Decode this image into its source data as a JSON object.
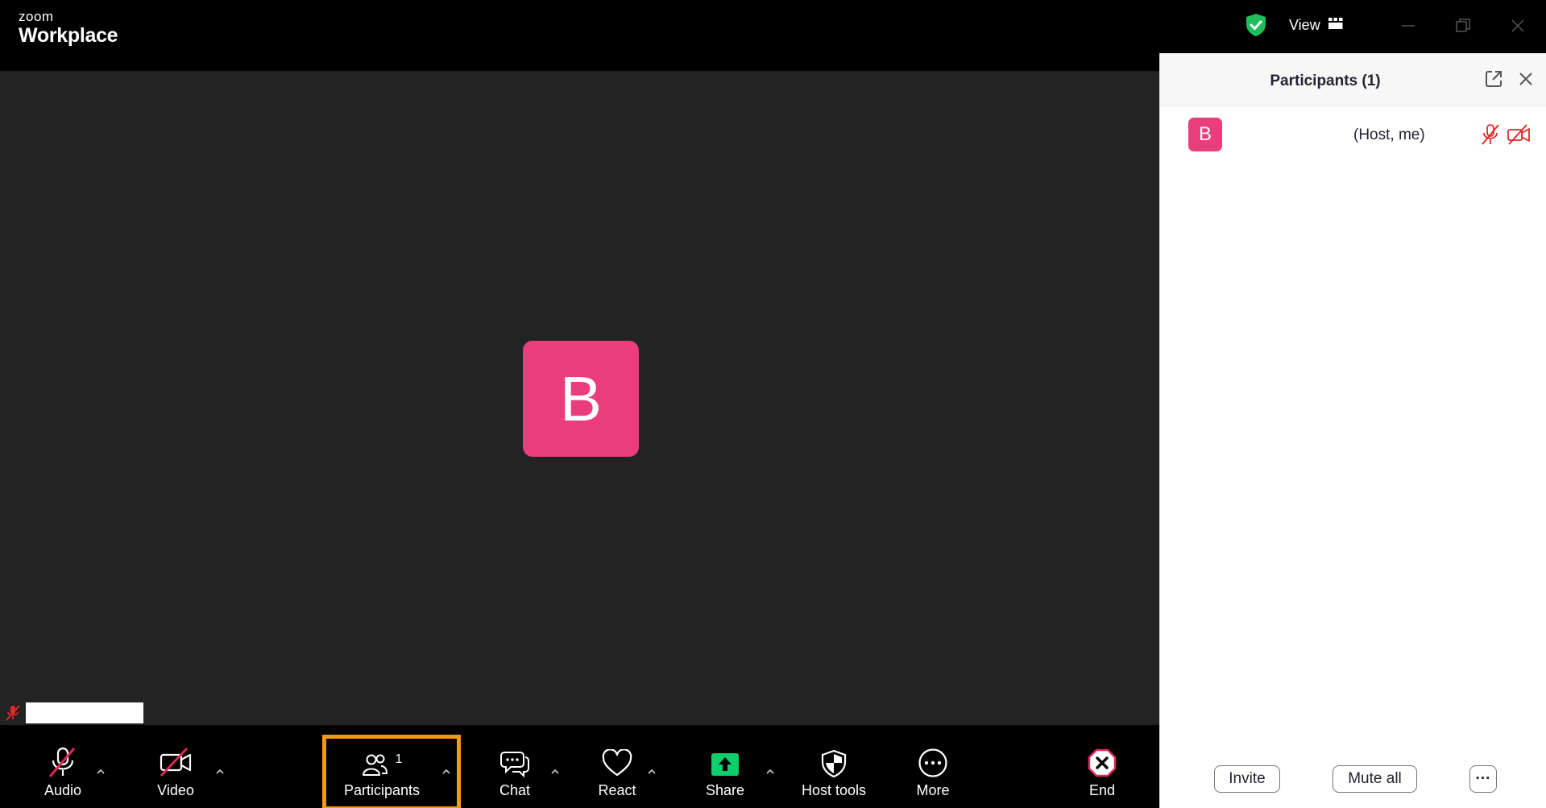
{
  "window": {
    "logo_top": "zoom",
    "logo_bottom": "Workplace",
    "view_label": "View"
  },
  "video": {
    "avatar_letter": "B"
  },
  "toolbar": {
    "audio_label": "Audio",
    "video_label": "Video",
    "participants_label": "Participants",
    "participants_count": "1",
    "chat_label": "Chat",
    "react_label": "React",
    "share_label": "Share",
    "host_tools_label": "Host tools",
    "more_label": "More",
    "end_label": "End"
  },
  "panel": {
    "title": "Participants (1)",
    "participants": [
      {
        "avatar_letter": "B",
        "role": "(Host, me)"
      }
    ],
    "invite_label": "Invite",
    "mute_all_label": "Mute all",
    "more_label": "···"
  },
  "colors": {
    "avatar": "#e93d7c",
    "share_green": "#0ed06a",
    "security_green": "#1fbe5b",
    "muted_red": "#e02828",
    "highlight_orange": "#f59b0b"
  }
}
